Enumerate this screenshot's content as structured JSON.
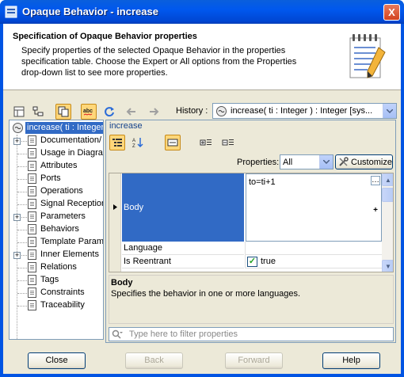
{
  "window": {
    "title": "Opaque Behavior - increase",
    "close_label": "X"
  },
  "header": {
    "title": "Specification of Opaque Behavior properties",
    "description_lines": [
      "Specify properties of the selected Opaque Behavior in the properties",
      "specification table. Choose the Expert or All options from the Properties",
      "drop-down list to see more properties."
    ]
  },
  "toolbar": {
    "history_label": "History :",
    "history_value": "increase( ti : Integer ) : Integer [sys..."
  },
  "tree": {
    "root": "increase( ti : Integer ) : Integer",
    "items": [
      {
        "label": "Documentation/",
        "expandable": true
      },
      {
        "label": "Usage in Diagrams",
        "expandable": false
      },
      {
        "label": "Attributes",
        "expandable": false
      },
      {
        "label": "Ports",
        "expandable": false
      },
      {
        "label": "Operations",
        "expandable": false
      },
      {
        "label": "Signal Receptions",
        "expandable": false
      },
      {
        "label": "Parameters",
        "expandable": true
      },
      {
        "label": "Behaviors",
        "expandable": false
      },
      {
        "label": "Template Parameters",
        "expandable": false
      },
      {
        "label": "Inner Elements",
        "expandable": true
      },
      {
        "label": "Relations",
        "expandable": false
      },
      {
        "label": "Tags",
        "expandable": false
      },
      {
        "label": "Constraints",
        "expandable": false
      },
      {
        "label": "Traceability",
        "expandable": false
      }
    ]
  },
  "panel": {
    "title": "increase",
    "properties_label": "Properties:",
    "properties_value": "All",
    "customize_label": "Customize",
    "rows": {
      "body": {
        "name": "Body",
        "value": "to=ti+1"
      },
      "language": {
        "name": "Language",
        "value": ""
      },
      "reentrant": {
        "name": "Is Reentrant",
        "value": "true",
        "checked": true
      }
    },
    "description": {
      "title": "Body",
      "text": "Specifies the behavior in one or more languages."
    },
    "filter_placeholder": "Type here to filter properties"
  },
  "buttons": {
    "close": "Close",
    "back": "Back",
    "forward": "Forward",
    "help": "Help"
  }
}
